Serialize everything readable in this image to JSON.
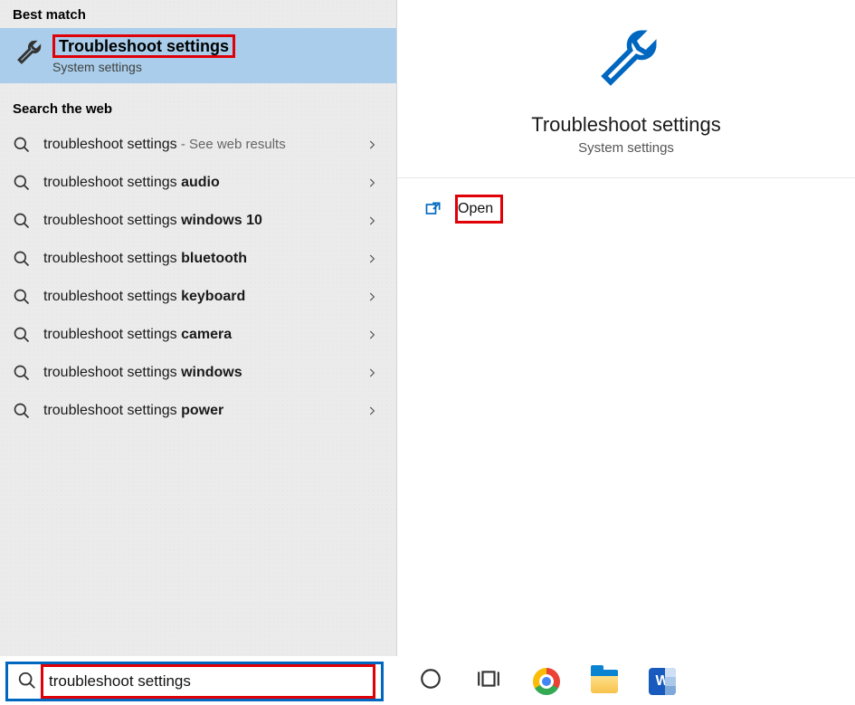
{
  "left": {
    "best_match_header": "Best match",
    "best_match": {
      "title": "Troubleshoot settings",
      "subtitle": "System settings"
    },
    "web_header": "Search the web",
    "web_items": [
      {
        "prefix": "troubleshoot settings",
        "bold": "",
        "hint": " - See web results"
      },
      {
        "prefix": "troubleshoot settings ",
        "bold": "audio",
        "hint": ""
      },
      {
        "prefix": "troubleshoot settings ",
        "bold": "windows 10",
        "hint": ""
      },
      {
        "prefix": "troubleshoot settings ",
        "bold": "bluetooth",
        "hint": ""
      },
      {
        "prefix": "troubleshoot settings ",
        "bold": "keyboard",
        "hint": ""
      },
      {
        "prefix": "troubleshoot settings ",
        "bold": "camera",
        "hint": ""
      },
      {
        "prefix": "troubleshoot settings ",
        "bold": "windows",
        "hint": ""
      },
      {
        "prefix": "troubleshoot settings ",
        "bold": "power",
        "hint": ""
      }
    ]
  },
  "right": {
    "title": "Troubleshoot settings",
    "subtitle": "System settings",
    "actions": {
      "open": "Open"
    }
  },
  "search": {
    "value": "troubleshoot settings"
  },
  "taskbar": {
    "word_letter": "W"
  }
}
